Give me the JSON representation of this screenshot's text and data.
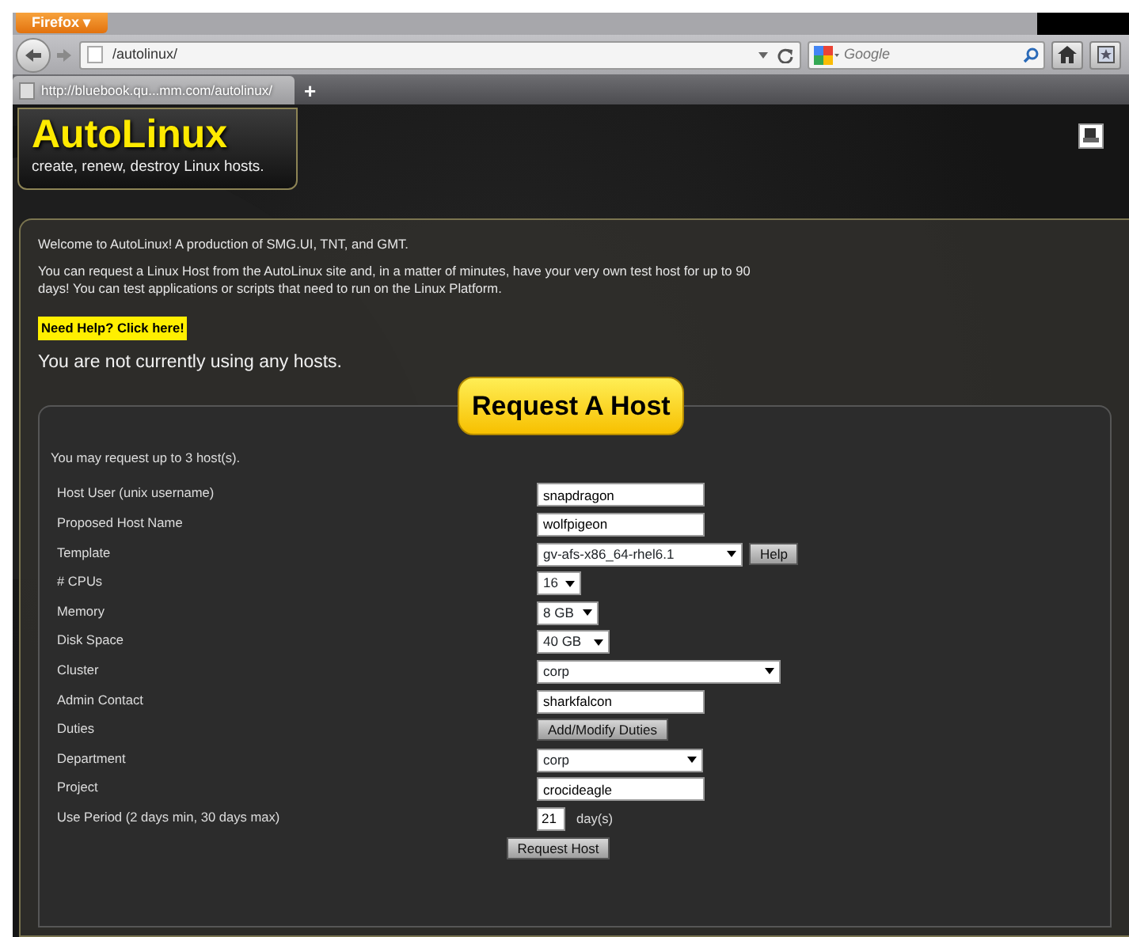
{
  "browser": {
    "menu_button": "Firefox ▾",
    "address": "/autolinux/",
    "search_placeholder": "Google",
    "tab": {
      "title": "http://bluebook.qu...mm.com/autolinux/",
      "selected": true
    },
    "new_tab": "+"
  },
  "header": {
    "logo": "AutoLinux",
    "tagline": "create, renew, destroy Linux hosts."
  },
  "intro": {
    "welcome": "Welcome to AutoLinux! A production of SMG.UI, TNT, and GMT.",
    "description": "You can request a Linux Host from the AutoLinux site and, in a matter of minutes, have your very own test host for up to 90 days!  You can test applications or scripts that need to run on the Linux Platform.",
    "help_link": "Need Help? Click here!",
    "status": "You are not currently using any hosts."
  },
  "request": {
    "title": "Request A Host",
    "limit": "You may request up to 3 host(s).",
    "rows": [
      {
        "label": "Host User (unix username)",
        "kind": "text",
        "value": "snapdragon"
      },
      {
        "label": "Proposed Host Name",
        "kind": "text",
        "value": "wolfpigeon"
      },
      {
        "label": "Template",
        "kind": "select",
        "value": "gv-afs-x86_64-rhel6.1",
        "button": "Help"
      },
      {
        "label": "# CPUs",
        "kind": "select",
        "value": "16"
      },
      {
        "label": "Memory",
        "kind": "select",
        "value": "8 GB"
      },
      {
        "label": "Disk Space",
        "kind": "select",
        "value": "40 GB"
      },
      {
        "label": "Cluster",
        "kind": "select",
        "value": "corp"
      },
      {
        "label": "Admin Contact",
        "kind": "text",
        "value": "sharkfalcon"
      },
      {
        "label": "Duties",
        "kind": "button",
        "value": "Add/Modify Duties"
      },
      {
        "label": "Department",
        "kind": "select",
        "value": "corp"
      },
      {
        "label": "Project",
        "kind": "text",
        "value": "crocideagle"
      },
      {
        "label": "Use Period (2 days min, 30 days max)",
        "kind": "days",
        "value": "21",
        "unit": "day(s)"
      }
    ],
    "submit": "Request Host"
  }
}
